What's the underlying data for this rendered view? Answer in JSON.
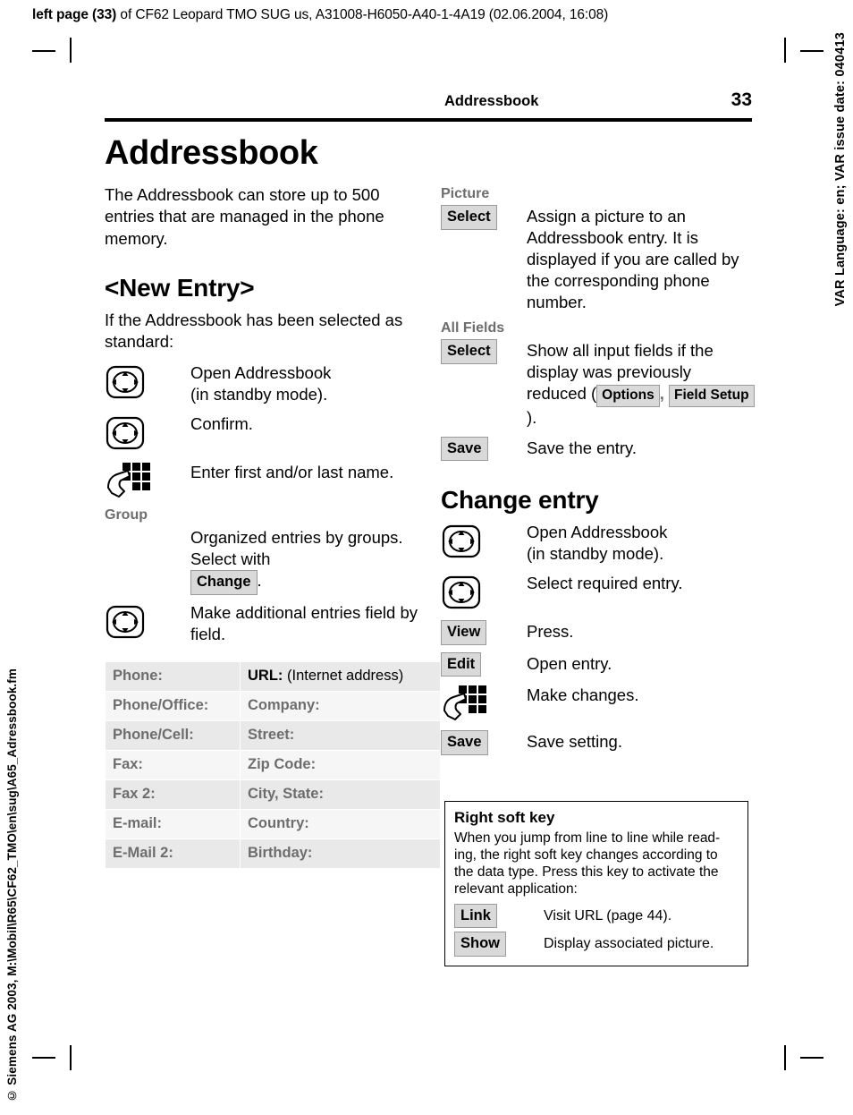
{
  "running_head": {
    "bold_part": "left page (33)",
    "rest": " of CF62 Leopard TMO SUG us, A31008-H6050-A40-1-4A19 (02.06.2004, 16:08)"
  },
  "vertical": {
    "right": "VAR Language: en; VAR issue date: 040413",
    "left": "© Siemens AG 2003, M:\\Mobil\\R65\\CF62_TMO\\en\\sug\\A65_Adressbook.fm"
  },
  "page_header": {
    "chapter": "Addressbook",
    "page_number": "33"
  },
  "left_column": {
    "title": "Addressbook",
    "intro": "The Addressbook can store up to 500 entries that are managed in the phone memory.",
    "section_title": "<New Entry>",
    "section_intro": "If the Addressbook has been selected as standard:",
    "steps": [
      {
        "icon": "nav-key-icon",
        "text": "Open Addressbook\n(in standby mode)."
      },
      {
        "icon": "nav-key-icon",
        "text": "Confirm."
      },
      {
        "icon": "keypad-icon",
        "text": "Enter first and/or last name."
      }
    ],
    "group_label": "Group",
    "group_text_a": "Organized entries by groups. Select with ",
    "group_key": "Change",
    "group_text_b": ".",
    "last_step": {
      "icon": "nav-key-icon",
      "text": "Make additional entries field by field."
    },
    "field_table": {
      "rows": [
        {
          "c1": "Phone:",
          "c2": "URL:",
          "c2_paren": " (Internet address)",
          "highlight": true
        },
        {
          "c1": "Phone/Office:",
          "c2": "Company:"
        },
        {
          "c1": "Phone/Cell:",
          "c2": "Street:"
        },
        {
          "c1": "Fax:",
          "c2": "Zip Code:"
        },
        {
          "c1": "Fax 2:",
          "c2": "City, State:"
        },
        {
          "c1": "E-mail:",
          "c2": "Country:"
        },
        {
          "c1": "E-Mail 2:",
          "c2": "Birthday:"
        }
      ]
    }
  },
  "right_column": {
    "picture_label": "Picture",
    "picture_key": "Select",
    "picture_text": "Assign a picture to an Addressbook entry. It is displayed if you are called by the corresponding phone number.",
    "allfields_label": "All Fields",
    "allfields_key": "Select",
    "allfields_text_a": "Show all input fields if the display was previously reduced (",
    "allfields_key_options": "Options",
    "allfields_text_mid": ", ",
    "allfields_key_fieldsetup": "Field Setup",
    "allfields_text_b": ").",
    "save_key": "Save",
    "save_text": "Save the entry.",
    "change_entry_title": "Change entry",
    "change_steps": [
      {
        "icon": "nav-key-icon",
        "text": "Open Addressbook\n(in standby mode)."
      },
      {
        "icon": "nav-key-icon",
        "text": "Select required entry."
      },
      {
        "icon": "soft-key",
        "key": "View",
        "text": "Press."
      },
      {
        "icon": "soft-key",
        "key": "Edit",
        "text": "Open entry."
      },
      {
        "icon": "keypad-icon",
        "text": "Make changes."
      },
      {
        "icon": "soft-key",
        "key": "Save",
        "text": "Save setting."
      }
    ]
  },
  "note_box": {
    "title": "Right soft key",
    "body": "When you jump from line to line while read-ing, the right soft key changes according to the data type. Press this key to activate the relevant application:",
    "rows": [
      {
        "key": "Link",
        "text": "Visit URL (page 44)."
      },
      {
        "key": "Show",
        "text": "Display associated picture."
      }
    ]
  },
  "colors": {
    "grey_label": "#6d6d6d",
    "key_bg": "#d9d9d9",
    "table_odd": "#e9e9e9",
    "table_even": "#f6f6f6"
  }
}
